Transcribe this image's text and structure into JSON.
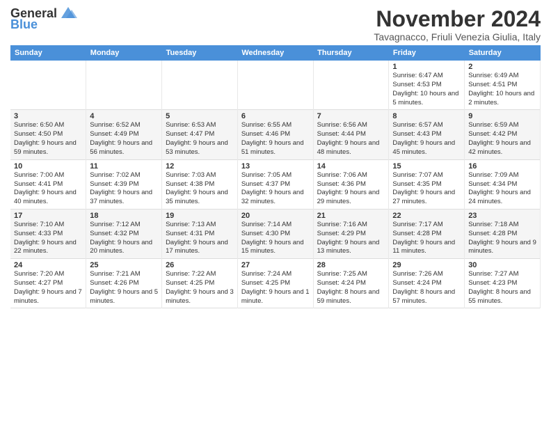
{
  "logo": {
    "text_general": "General",
    "text_blue": "Blue"
  },
  "title": "November 2024",
  "subtitle": "Tavagnacco, Friuli Venezia Giulia, Italy",
  "headers": [
    "Sunday",
    "Monday",
    "Tuesday",
    "Wednesday",
    "Thursday",
    "Friday",
    "Saturday"
  ],
  "weeks": [
    [
      {
        "day": "",
        "info": ""
      },
      {
        "day": "",
        "info": ""
      },
      {
        "day": "",
        "info": ""
      },
      {
        "day": "",
        "info": ""
      },
      {
        "day": "",
        "info": ""
      },
      {
        "day": "1",
        "info": "Sunrise: 6:47 AM\nSunset: 4:53 PM\nDaylight: 10 hours and 5 minutes."
      },
      {
        "day": "2",
        "info": "Sunrise: 6:49 AM\nSunset: 4:51 PM\nDaylight: 10 hours and 2 minutes."
      }
    ],
    [
      {
        "day": "3",
        "info": "Sunrise: 6:50 AM\nSunset: 4:50 PM\nDaylight: 9 hours and 59 minutes."
      },
      {
        "day": "4",
        "info": "Sunrise: 6:52 AM\nSunset: 4:49 PM\nDaylight: 9 hours and 56 minutes."
      },
      {
        "day": "5",
        "info": "Sunrise: 6:53 AM\nSunset: 4:47 PM\nDaylight: 9 hours and 53 minutes."
      },
      {
        "day": "6",
        "info": "Sunrise: 6:55 AM\nSunset: 4:46 PM\nDaylight: 9 hours and 51 minutes."
      },
      {
        "day": "7",
        "info": "Sunrise: 6:56 AM\nSunset: 4:44 PM\nDaylight: 9 hours and 48 minutes."
      },
      {
        "day": "8",
        "info": "Sunrise: 6:57 AM\nSunset: 4:43 PM\nDaylight: 9 hours and 45 minutes."
      },
      {
        "day": "9",
        "info": "Sunrise: 6:59 AM\nSunset: 4:42 PM\nDaylight: 9 hours and 42 minutes."
      }
    ],
    [
      {
        "day": "10",
        "info": "Sunrise: 7:00 AM\nSunset: 4:41 PM\nDaylight: 9 hours and 40 minutes."
      },
      {
        "day": "11",
        "info": "Sunrise: 7:02 AM\nSunset: 4:39 PM\nDaylight: 9 hours and 37 minutes."
      },
      {
        "day": "12",
        "info": "Sunrise: 7:03 AM\nSunset: 4:38 PM\nDaylight: 9 hours and 35 minutes."
      },
      {
        "day": "13",
        "info": "Sunrise: 7:05 AM\nSunset: 4:37 PM\nDaylight: 9 hours and 32 minutes."
      },
      {
        "day": "14",
        "info": "Sunrise: 7:06 AM\nSunset: 4:36 PM\nDaylight: 9 hours and 29 minutes."
      },
      {
        "day": "15",
        "info": "Sunrise: 7:07 AM\nSunset: 4:35 PM\nDaylight: 9 hours and 27 minutes."
      },
      {
        "day": "16",
        "info": "Sunrise: 7:09 AM\nSunset: 4:34 PM\nDaylight: 9 hours and 24 minutes."
      }
    ],
    [
      {
        "day": "17",
        "info": "Sunrise: 7:10 AM\nSunset: 4:33 PM\nDaylight: 9 hours and 22 minutes."
      },
      {
        "day": "18",
        "info": "Sunrise: 7:12 AM\nSunset: 4:32 PM\nDaylight: 9 hours and 20 minutes."
      },
      {
        "day": "19",
        "info": "Sunrise: 7:13 AM\nSunset: 4:31 PM\nDaylight: 9 hours and 17 minutes."
      },
      {
        "day": "20",
        "info": "Sunrise: 7:14 AM\nSunset: 4:30 PM\nDaylight: 9 hours and 15 minutes."
      },
      {
        "day": "21",
        "info": "Sunrise: 7:16 AM\nSunset: 4:29 PM\nDaylight: 9 hours and 13 minutes."
      },
      {
        "day": "22",
        "info": "Sunrise: 7:17 AM\nSunset: 4:28 PM\nDaylight: 9 hours and 11 minutes."
      },
      {
        "day": "23",
        "info": "Sunrise: 7:18 AM\nSunset: 4:28 PM\nDaylight: 9 hours and 9 minutes."
      }
    ],
    [
      {
        "day": "24",
        "info": "Sunrise: 7:20 AM\nSunset: 4:27 PM\nDaylight: 9 hours and 7 minutes."
      },
      {
        "day": "25",
        "info": "Sunrise: 7:21 AM\nSunset: 4:26 PM\nDaylight: 9 hours and 5 minutes."
      },
      {
        "day": "26",
        "info": "Sunrise: 7:22 AM\nSunset: 4:25 PM\nDaylight: 9 hours and 3 minutes."
      },
      {
        "day": "27",
        "info": "Sunrise: 7:24 AM\nSunset: 4:25 PM\nDaylight: 9 hours and 1 minute."
      },
      {
        "day": "28",
        "info": "Sunrise: 7:25 AM\nSunset: 4:24 PM\nDaylight: 8 hours and 59 minutes."
      },
      {
        "day": "29",
        "info": "Sunrise: 7:26 AM\nSunset: 4:24 PM\nDaylight: 8 hours and 57 minutes."
      },
      {
        "day": "30",
        "info": "Sunrise: 7:27 AM\nSunset: 4:23 PM\nDaylight: 8 hours and 55 minutes."
      }
    ]
  ]
}
